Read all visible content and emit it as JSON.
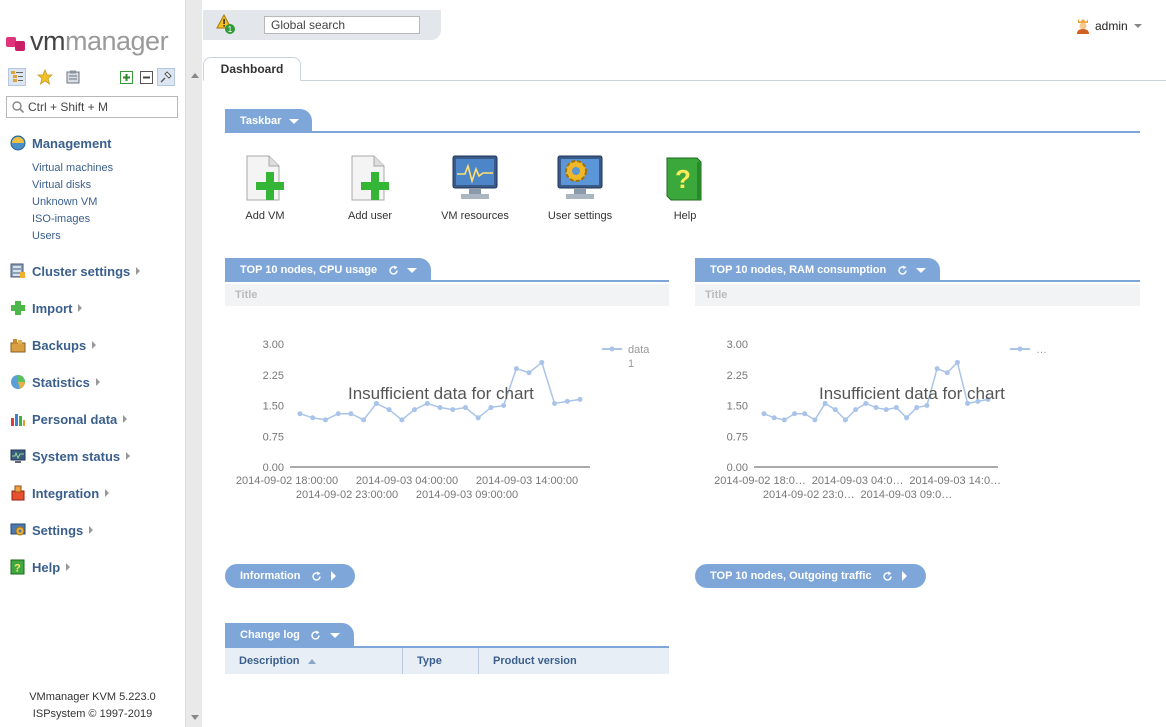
{
  "app": {
    "logo_vm": "vm",
    "logo_manager": "manager",
    "footer_version": "VMmanager KVM 5.223.0",
    "footer_copyright": "ISPsystem © 1997-2019"
  },
  "sidebar": {
    "search_placeholder": "Ctrl + Shift + M",
    "groups": [
      {
        "label": "Management",
        "icon": "management-icon"
      },
      {
        "label": "Cluster settings",
        "icon": "cluster-icon"
      },
      {
        "label": "Import",
        "icon": "import-icon"
      },
      {
        "label": "Backups",
        "icon": "backups-icon"
      },
      {
        "label": "Statistics",
        "icon": "statistics-icon"
      },
      {
        "label": "Personal data",
        "icon": "personal-data-icon"
      },
      {
        "label": "System status",
        "icon": "system-status-icon"
      },
      {
        "label": "Integration",
        "icon": "integration-icon"
      },
      {
        "label": "Settings",
        "icon": "settings-icon"
      },
      {
        "label": "Help",
        "icon": "help-icon"
      }
    ],
    "management_items": [
      "Virtual machines",
      "Virtual disks",
      "Unknown VM",
      "ISO-images",
      "Users"
    ]
  },
  "topbar": {
    "alert_count": "1",
    "search_placeholder": "Global search",
    "user": "admin"
  },
  "tabs": [
    {
      "label": "Dashboard"
    }
  ],
  "taskbar": {
    "title": "Taskbar",
    "items": [
      {
        "label": "Add VM",
        "icon": "add-vm-icon"
      },
      {
        "label": "Add user",
        "icon": "add-user-icon"
      },
      {
        "label": "VM resources",
        "icon": "vm-resources-icon"
      },
      {
        "label": "User settings",
        "icon": "user-settings-icon"
      },
      {
        "label": "Help",
        "icon": "help-book-icon"
      }
    ]
  },
  "panels": {
    "cpu": {
      "title": "TOP 10 nodes, CPU usage",
      "subtitle": "Title",
      "message": "Insufficient data for chart"
    },
    "ram": {
      "title": "TOP 10 nodes, RAM consumption",
      "subtitle": "Title",
      "message": "Insufficient data for chart"
    },
    "information": {
      "title": "Information"
    },
    "traffic": {
      "title": "TOP 10 nodes, Outgoing traffic"
    },
    "changelog": {
      "title": "Change log",
      "columns": [
        "Description",
        "Type",
        "Product version"
      ]
    }
  },
  "chart_data": [
    {
      "type": "line",
      "title": "Title",
      "ylim": [
        0,
        3
      ],
      "y_ticks": [
        "3.00",
        "2.25",
        "1.50",
        "0.75",
        "0.00"
      ],
      "x_ticks_top": [
        "2014-09-02 18:00:00",
        "2014-09-03 04:00:00",
        "2014-09-03 14:00:00"
      ],
      "x_ticks_bottom": [
        "2014-09-02 23:00:00",
        "2014-09-03 09:00:00"
      ],
      "legend": "top-right",
      "series": [
        {
          "name": "data 1",
          "values": [
            1.3,
            1.2,
            1.15,
            1.3,
            1.3,
            1.15,
            1.55,
            1.4,
            1.15,
            1.4,
            1.55,
            1.45,
            1.4,
            1.45,
            1.2,
            1.45,
            1.5,
            2.4,
            2.3,
            2.55,
            1.55,
            1.6,
            1.65
          ]
        }
      ]
    },
    {
      "type": "line",
      "title": "Title",
      "ylim": [
        0,
        3
      ],
      "y_ticks": [
        "3.00",
        "2.25",
        "1.50",
        "0.75",
        "0.00"
      ],
      "x_ticks_top": [
        "2014-09-02 18:0…",
        "2014-09-03 04:0…",
        "2014-09-03 14:0…"
      ],
      "x_ticks_bottom": [
        "2014-09-02 23:0…",
        "2014-09-03 09:0…"
      ],
      "legend": "top-right",
      "series": [
        {
          "name": "…",
          "values": [
            1.3,
            1.2,
            1.15,
            1.3,
            1.3,
            1.15,
            1.55,
            1.4,
            1.15,
            1.4,
            1.55,
            1.45,
            1.4,
            1.45,
            1.2,
            1.45,
            1.5,
            2.4,
            2.3,
            2.55,
            1.55,
            1.6,
            1.65
          ]
        }
      ]
    }
  ],
  "colors": {
    "accent": "#7ea6d8",
    "link": "#3a5f8c",
    "series": "#a9c4e8"
  }
}
